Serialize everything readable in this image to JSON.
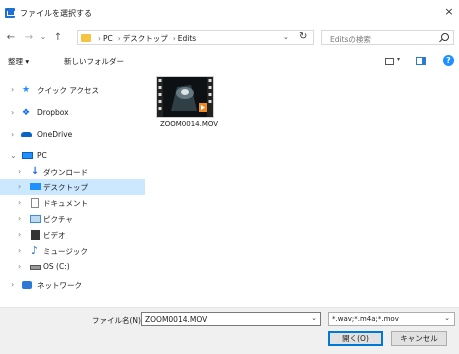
{
  "window": {
    "title": "ファイルを選択する",
    "close_glyph": "×"
  },
  "nav_buttons": {
    "back": "←",
    "forward": "→",
    "recent": "⌄",
    "up": "↑"
  },
  "address": {
    "crumbs": [
      "PC",
      "デスクトップ",
      "Edits"
    ],
    "separator": "›",
    "dropdown": "⌄",
    "refresh": "↻"
  },
  "search": {
    "placeholder": "Editsの検索"
  },
  "toolbar": {
    "organize": "整理 ▾",
    "new_folder": "新しいフォルダー"
  },
  "sidebar": {
    "items": [
      {
        "label": "クイック アクセス",
        "icon": "star-icon",
        "color": "#1e90ff"
      },
      {
        "label": "Dropbox",
        "icon": "dropbox-icon",
        "color": "#0061fe"
      },
      {
        "label": "OneDrive",
        "icon": "cloud-icon",
        "color": "#0a64c8"
      },
      {
        "label": "PC",
        "icon": "computer-icon",
        "color": "#1e90ff"
      },
      {
        "label": "ダウンロード",
        "icon": "download-icon",
        "color": "#1e6fd6"
      },
      {
        "label": "デスクトップ",
        "icon": "desktop-icon",
        "color": "#1e90ff"
      },
      {
        "label": "ドキュメント",
        "icon": "document-icon",
        "color": "#888888"
      },
      {
        "label": "ピクチャ",
        "icon": "pictures-icon",
        "color": "#3a8fd6"
      },
      {
        "label": "ビデオ",
        "icon": "video-icon",
        "color": "#333333"
      },
      {
        "label": "ミュージック",
        "icon": "music-icon",
        "color": "#1e6fd6"
      },
      {
        "label": "OS (C:)",
        "icon": "drive-icon",
        "color": "#555555"
      },
      {
        "label": "ネットワーク",
        "icon": "network-icon",
        "color": "#2a7ad6"
      }
    ]
  },
  "files": [
    {
      "name": "ZOOM0014.MOV",
      "icon": "video-file-icon"
    }
  ],
  "bottom": {
    "filename_label": "ファイル名(N):",
    "filename_value": "ZOOM0014.MOV",
    "filetype_value": "*.wav;*.m4a;*.mov",
    "open_button": "開く(O)",
    "cancel_button": "キャンセル"
  },
  "colors": {
    "selection": "#cce8ff",
    "accent": "#0078d7",
    "help": "#1e90ff"
  }
}
